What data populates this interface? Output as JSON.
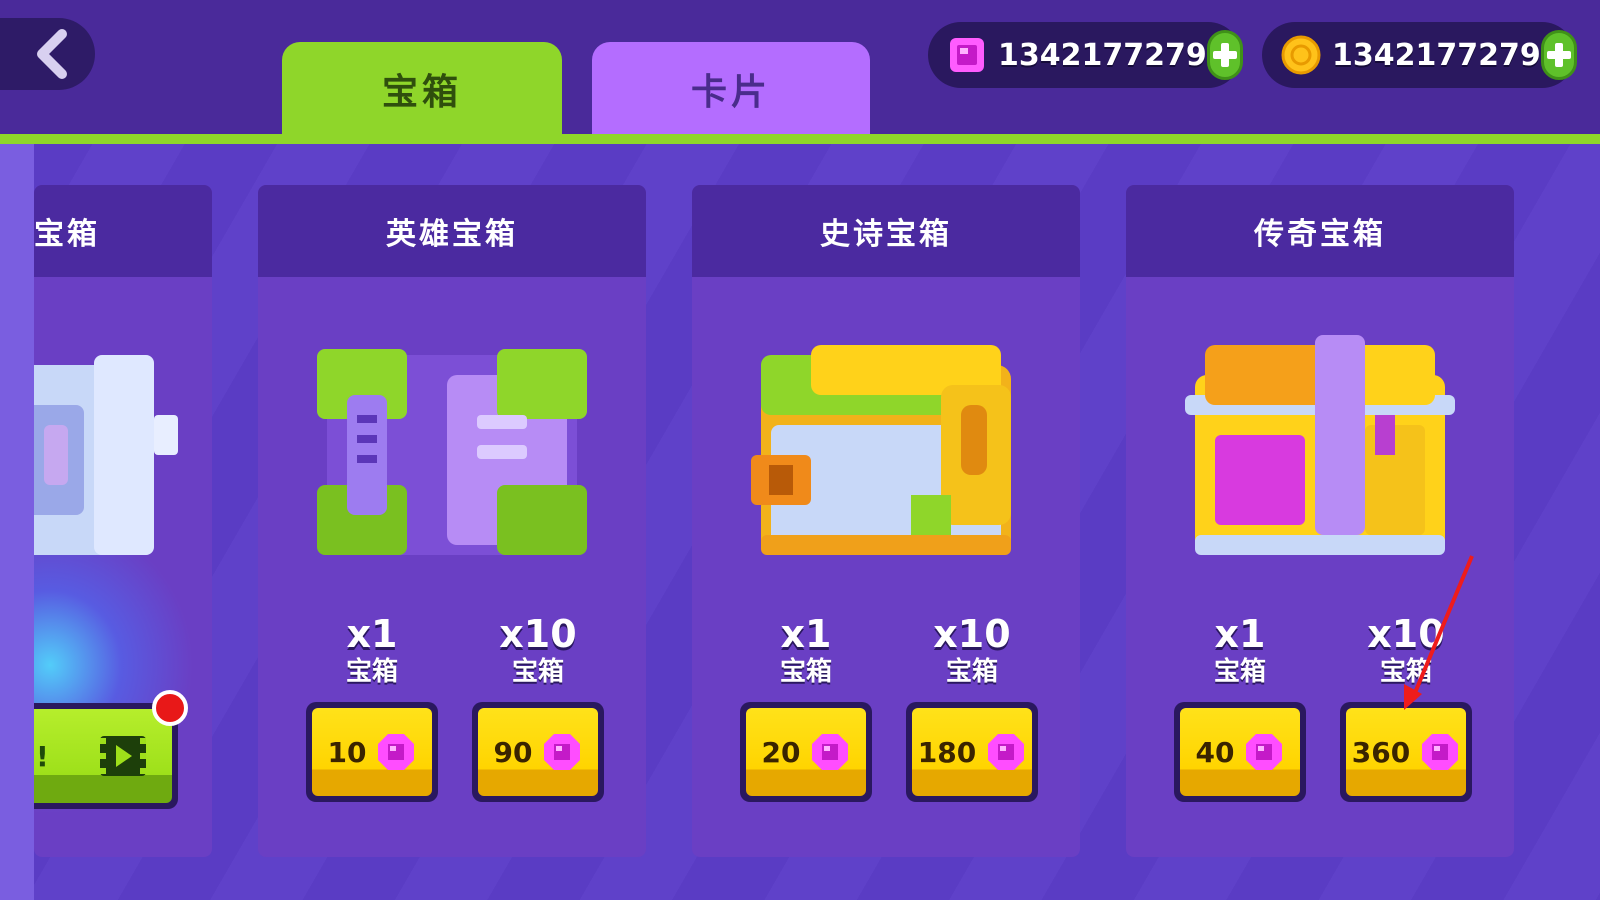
{
  "tabs": {
    "chest": "宝箱",
    "cards": "卡片"
  },
  "currency": {
    "gems": {
      "icon": "gem-icon",
      "value": "1342177279"
    },
    "coins": {
      "icon": "coin-icon",
      "value": "1342177279"
    }
  },
  "panels": {
    "partial": {
      "title": "宝箱",
      "ad_label": "!"
    },
    "hero": {
      "title": "英雄宝箱",
      "single": {
        "count": "x1",
        "label": "宝箱",
        "price": "10"
      },
      "multi": {
        "count": "x10",
        "label": "宝箱",
        "price": "90"
      }
    },
    "epic": {
      "title": "史诗宝箱",
      "single": {
        "count": "x1",
        "label": "宝箱",
        "price": "20"
      },
      "multi": {
        "count": "x10",
        "label": "宝箱",
        "price": "180"
      }
    },
    "legend": {
      "title": "传奇宝箱",
      "single": {
        "count": "x1",
        "label": "宝箱",
        "price": "40"
      },
      "multi": {
        "count": "x10",
        "label": "宝箱",
        "price": "360"
      }
    }
  },
  "colors": {
    "accent_green": "#8fd62a",
    "tab_purple": "#b46dff",
    "price_yellow": "#ffd400",
    "gem_pink": "#e02fe0"
  }
}
